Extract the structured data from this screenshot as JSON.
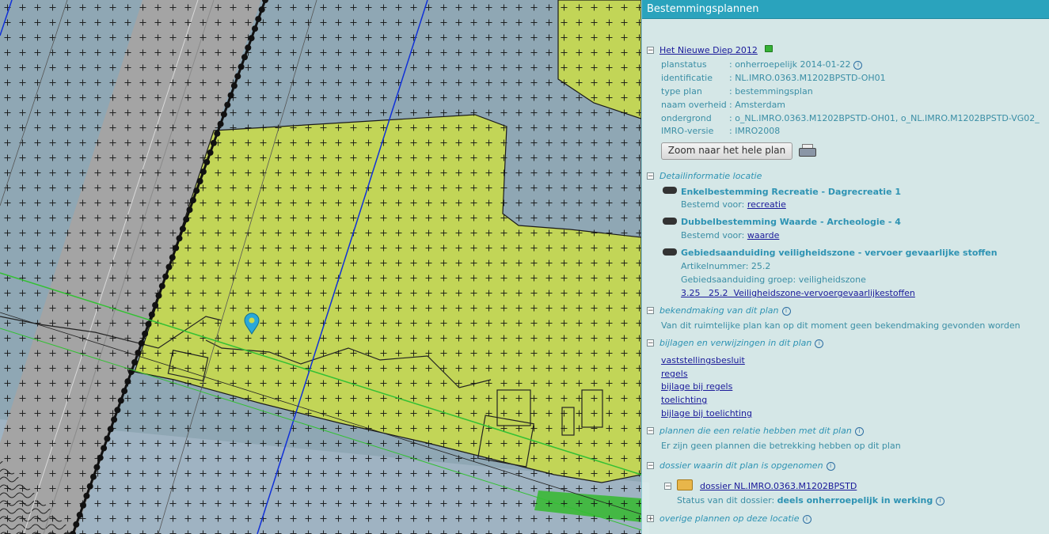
{
  "panel": {
    "title": "Bestemmingsplannen",
    "plan": {
      "name": "Het Nieuwe Diep 2012",
      "rows": [
        {
          "key": "planstatus",
          "value": ": onherroepelijk 2014-01-22"
        },
        {
          "key": "identificatie",
          "value": ": NL.IMRO.0363.M1202BPSTD-OH01"
        },
        {
          "key": "type plan",
          "value": ": bestemmingsplan"
        },
        {
          "key": "naam overheid",
          "value": ": Amsterdam"
        },
        {
          "key": "ondergrond",
          "value": ": o_NL.IMRO.0363.M1202BPSTD-OH01, o_NL.IMRO.M1202BPSTD-VG02_"
        },
        {
          "key": "IMRO-versie",
          "value": ": IMRO2008"
        }
      ],
      "zoom_button": "Zoom naar het hele plan"
    },
    "detail": {
      "heading": "Detailinformatie locatie",
      "items": [
        {
          "title": "Enkelbestemming Recreatie - Dagrecreatie 1",
          "label": "Bestemd voor:",
          "link": "recreatie"
        },
        {
          "title": "Dubbelbestemming Waarde - Archeologie - 4",
          "label": "Bestemd voor:",
          "link": "waarde"
        },
        {
          "title": "Gebiedsaanduiding veiligheidszone - vervoer gevaarlijke stoffen",
          "line1": "Artikelnummer: 25.2",
          "line2": "Gebiedsaanduiding groep: veiligheidszone",
          "link": "3.25   25.2  Veiligheidszone-vervoergevaarlijkestoffen"
        }
      ]
    },
    "bekendmaking": {
      "heading": "bekendmaking van dit plan",
      "text": "Van dit ruimtelijke plan kan op dit moment geen bekendmaking gevonden worden"
    },
    "bijlagen": {
      "heading": "bijlagen en verwijzingen in dit plan",
      "links": [
        "vaststellingsbesluit",
        "regels",
        "bijlage bij regels",
        "toelichting",
        "bijlage bij toelichting"
      ]
    },
    "relatie": {
      "heading": "plannen die een relatie hebben met dit plan",
      "text": "Er zijn geen plannen die betrekking hebben op dit plan"
    },
    "dossier": {
      "heading": "dossier waarin dit plan is opgenomen",
      "link": "dossier NL.IMRO.0363.M1202BPSTD",
      "status_label": "Status van dit dossier:",
      "status_value": "deels onherroepelijk in werking"
    },
    "overige": {
      "heading": "overige plannen op deze locatie"
    }
  },
  "colors": {
    "header": "#2aa3bd",
    "plan_area": "#c9dc4a",
    "water": "#8fa7b4",
    "highway": "#9b9b9b",
    "marker": "#2aa8d8"
  }
}
